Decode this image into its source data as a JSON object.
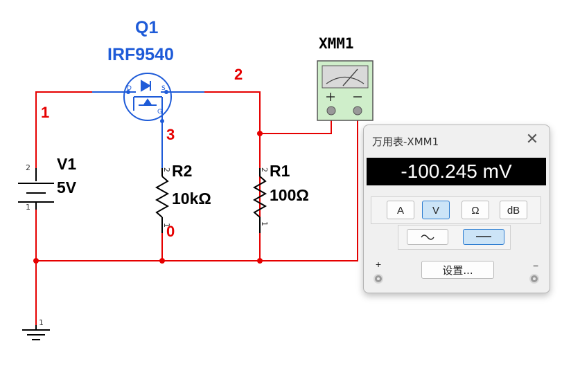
{
  "schematic": {
    "q1_ref": "Q1",
    "q1_model": "IRF9540",
    "net_1": "1",
    "net_2": "2",
    "net_3": "3",
    "net_0": "0",
    "v1_ref": "V1",
    "v1_value": "5V",
    "r2_ref": "R2",
    "r2_value": "10kΩ",
    "r1_ref": "R1",
    "r1_value": "100Ω",
    "instrument_ref": "XMM1",
    "meter_plus": "+",
    "meter_minus": "−",
    "pin_2": "2",
    "pin_1": "1",
    "pin_d": "D",
    "pin_s": "S",
    "pin_g": "G"
  },
  "multimeter": {
    "title": "万用表-XMM1",
    "reading": "-100.245 mV",
    "modes": [
      "A",
      "V",
      "Ω",
      "dB"
    ],
    "active_mode": "V",
    "signal_modes": [
      "ac",
      "dc"
    ],
    "active_signal_mode": "dc",
    "settings_label": "设置...",
    "plus_label": "+",
    "minus_label": "−"
  },
  "colors": {
    "wire": "#e60000",
    "component": "#1e5bd8",
    "net_label": "#e60000"
  }
}
